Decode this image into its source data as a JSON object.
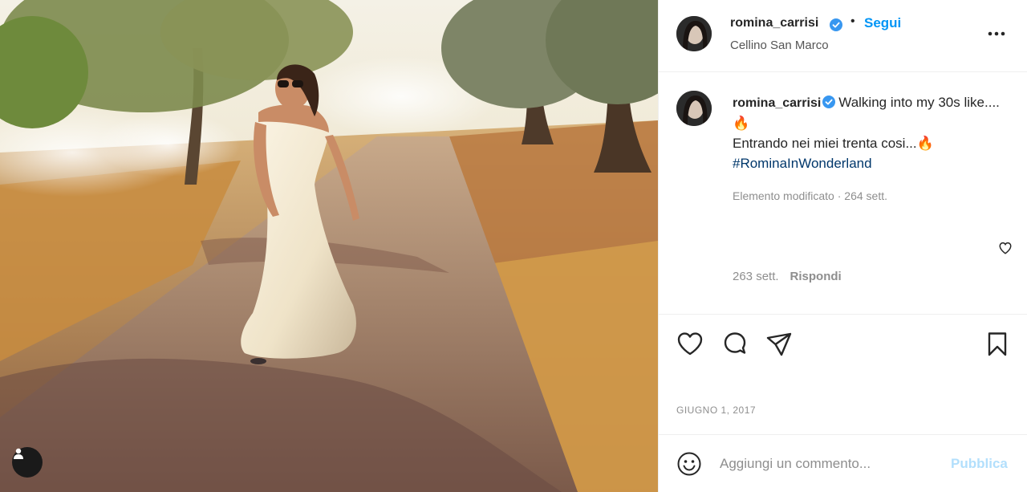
{
  "post": {
    "image_alt": "Woman in a white satin dress walking on a country road between olive trees",
    "username": "romina_carrisi",
    "separator": "•",
    "follow_label": "Segui",
    "location": "Cellino San Marco",
    "caption": {
      "line1": "Walking into my 30s like.... 🔥",
      "line2": "Entrando nei miei trenta cosi...🔥",
      "hashtag": "#RominaInWonderland"
    },
    "edited_meta": "Elemento modificato · 264 sett.",
    "comment_age": "263 sett.",
    "reply_label": "Rispondi",
    "date": "GIUGNO 1, 2017",
    "comment_placeholder": "Aggiungi un commento...",
    "publish_label": "Pubblica"
  },
  "colors": {
    "accent": "#0095f6",
    "verified": "#3897f0",
    "publish_disabled": "#b2dffc",
    "muted_text": "#8e8e8e"
  },
  "icons": [
    "user-tag-icon",
    "verified-badge-icon",
    "more-options-icon",
    "heart-icon",
    "comment-icon",
    "share-icon",
    "bookmark-icon",
    "emoji-icon"
  ]
}
